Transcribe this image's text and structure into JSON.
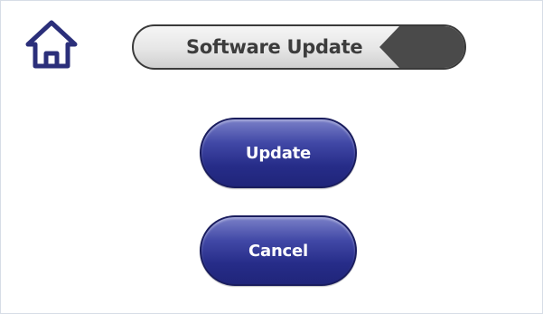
{
  "header": {
    "title": "Software Update",
    "home_icon": "home-icon",
    "back_icon": "back-arrow-icon"
  },
  "actions": {
    "update_label": "Update",
    "cancel_label": "Cancel"
  },
  "colors": {
    "accent_navy": "#262c88",
    "home_icon_color": "#2b2f7a",
    "title_back_cap": "#4a4a4a"
  }
}
